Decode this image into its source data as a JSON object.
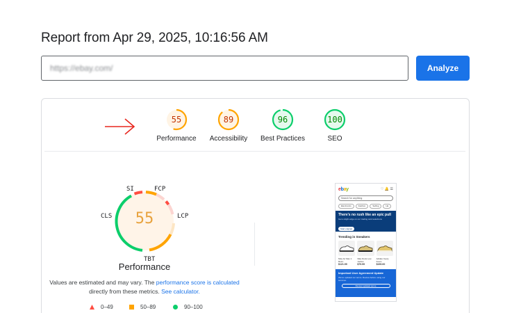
{
  "report": {
    "title": "Report from Apr 29, 2025, 10:16:56 AM"
  },
  "search": {
    "value": "https://ebay.com/"
  },
  "analyze": {
    "label": "Analyze"
  },
  "categories": [
    {
      "score": "55",
      "label": "Performance",
      "fraction": 0.55,
      "status": "average"
    },
    {
      "score": "89",
      "label": "Accessibility",
      "fraction": 0.89,
      "status": "average"
    },
    {
      "score": "96",
      "label": "Best Practices",
      "fraction": 0.96,
      "status": "pass"
    },
    {
      "score": "100",
      "label": "SEO",
      "fraction": 1.0,
      "status": "pass"
    }
  ],
  "colors": {
    "pass": "#0cce6b",
    "average": "#ffa400",
    "fail": "#ff4e42",
    "accent": "#1a73e8"
  },
  "performance": {
    "score": "55",
    "title": "Performance",
    "metrics": {
      "si": "SI",
      "fcp": "FCP",
      "lcp": "LCP",
      "tbt": "TBT",
      "cls": "CLS"
    }
  },
  "note": {
    "text1": "Values are estimated and may vary. The ",
    "link1": "performance score is calculated",
    "text2": "directly from these metrics. ",
    "link2": "See calculator."
  },
  "legend": [
    {
      "range": "0–49",
      "shape": "triangle"
    },
    {
      "range": "50–89",
      "shape": "square"
    },
    {
      "range": "90–100",
      "shape": "circle"
    }
  ],
  "screenshot": {
    "logo": "ebay",
    "search_placeholder": "Search for anything",
    "chips": [
      "Electronics",
      "Fashion",
      "Selling",
      "Ha"
    ],
    "banner_title": "There's no rush like an epic pull",
    "banner_sub": "Get a slight edge on our trading card selections",
    "banner_button": "Start original",
    "trending": "Trending in Sneakers",
    "products": [
      {
        "name": "Nike Air Max 1 Retro",
        "price": "$121.99"
      },
      {
        "name": "Nike Dunk Low Jordan",
        "price": "$79.99"
      },
      {
        "name": "Adidas Yeezy Foam",
        "price": "$150.00"
      }
    ],
    "notice_title": "Important User Agreement Update",
    "notice_sub": "We've updated our terms. Review before using our services.",
    "notice_button": "Review updated terms"
  }
}
